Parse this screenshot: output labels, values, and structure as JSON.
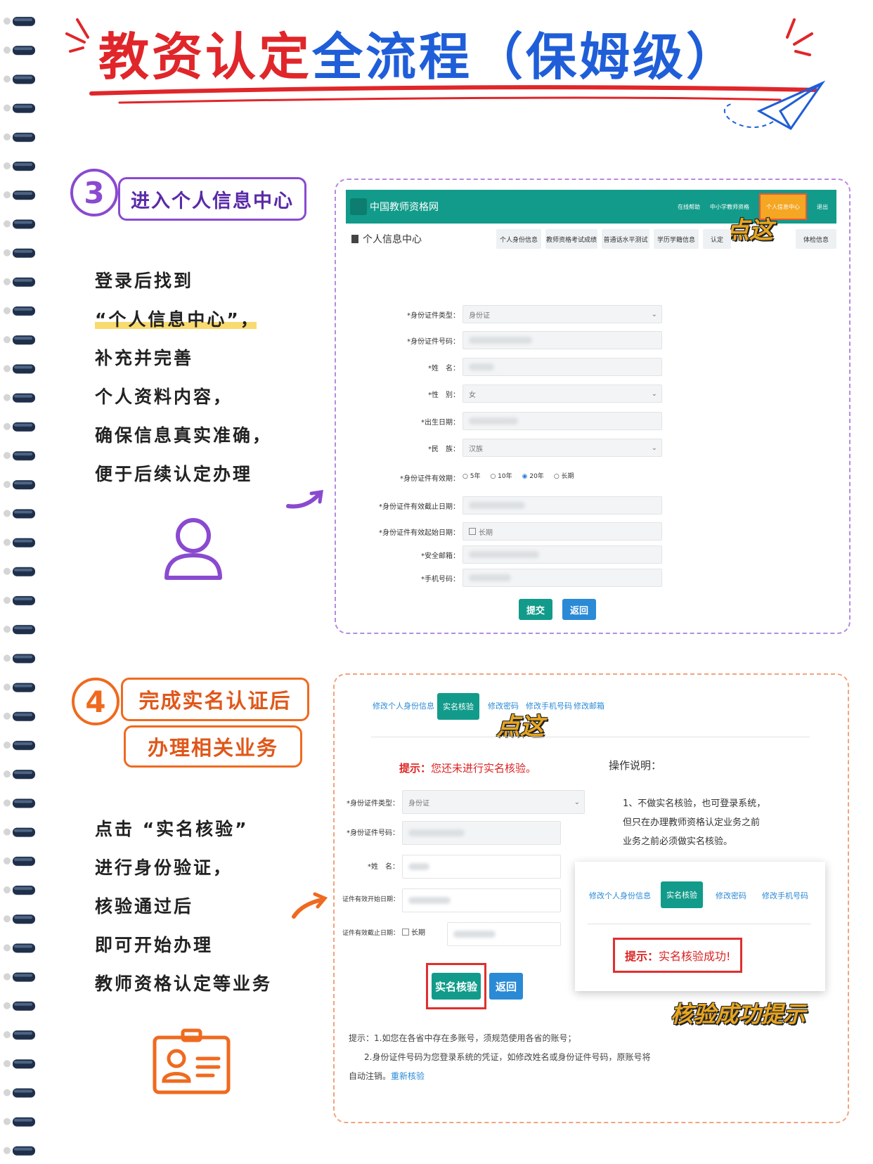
{
  "title": {
    "part1": "教资认定",
    "part2": "全流程（保姆级）"
  },
  "step3": {
    "number": "3",
    "heading": "进入个人信息中心",
    "lines": [
      "登录后找到",
      "“个人信息中心”，",
      "补充并完善",
      "个人资料内容，",
      "确保信息真实准确，",
      "便于后续认定办理"
    ],
    "icon": "person-icon"
  },
  "screen3": {
    "site_name": "中国教师资格网",
    "header_links": [
      "在线帮助",
      "中小学教师资格",
      "个人信息中心",
      "退出"
    ],
    "callout": "点这",
    "section_title": "个人信息中心",
    "tabs": [
      "个人身份信息",
      "教师资格考试成绩",
      "普通话水平测试",
      "学历学籍信息",
      "认定",
      "体检信息"
    ],
    "fields": [
      {
        "label": "*身份证件类型：",
        "value": "身份证",
        "select": true
      },
      {
        "label": "*身份证件号码：",
        "value": ""
      },
      {
        "label": "*姓　名：",
        "value": ""
      },
      {
        "label": "*性　别：",
        "value": "女",
        "select": true
      },
      {
        "label": "*出生日期：",
        "value": ""
      },
      {
        "label": "*民　族：",
        "value": "汉族",
        "select": true
      }
    ],
    "validity_label": "*身份证件有效期：",
    "validity_options": [
      "5年",
      "10年",
      "20年",
      "长期"
    ],
    "validity_selected": "20年",
    "fields2": [
      {
        "label": "*身份证件有效截止日期：",
        "value": ""
      },
      {
        "label": "*身份证件有效起始日期：",
        "value": "长期",
        "checkbox": true
      },
      {
        "label": "*安全邮箱：",
        "value": ""
      },
      {
        "label": "*手机号码：",
        "value": ""
      }
    ],
    "submit": "提交",
    "back": "返回"
  },
  "step4": {
    "number": "4",
    "heading1": "完成实名认证后",
    "heading2": "办理相关业务",
    "lines": [
      "点击 “实名核验”",
      "进行身份验证，",
      "核验通过后",
      "即可开始办理",
      "教师资格认定等业务"
    ],
    "icon": "id-card-icon"
  },
  "screen4": {
    "tabs": [
      "修改个人身份信息",
      "实名核验",
      "修改密码",
      "修改手机号码",
      "修改邮箱"
    ],
    "callout": "点这",
    "notice_label": "提示：",
    "notice_text": "您还未进行实名核验。",
    "instructions_title": "操作说明：",
    "instructions": [
      "1、不做实名核验，也可登录系统，",
      "但只在办理教师资格认定业务之前",
      "业务之前必须做实名核验。"
    ],
    "fields": [
      {
        "label": "*身份证件类型：",
        "value": "身份证",
        "select": true
      },
      {
        "label": "*身份证件号码：",
        "value": ""
      },
      {
        "label": "*姓　名：",
        "value": ""
      },
      {
        "label": "证件有效开始日期：",
        "value": ""
      },
      {
        "label": "证件有效截止日期：",
        "value": "长期",
        "checkbox": true
      }
    ],
    "verify_button": "实名核验",
    "back_button": "返回",
    "tips": [
      "提示：1.如您在各省中存在多账号，须规范使用各省的账号；",
      "2.身份证件号码为您登录系统的凭证，如修改姓名或身份证件号码，原账号将",
      "自动注销。"
    ],
    "tips_link": "重新核验",
    "success_tabs": [
      "修改个人身份信息",
      "实名核验",
      "修改密码",
      "修改手机号码"
    ],
    "success_label": "提示：",
    "success_text": "实名核验成功!",
    "success_caption": "核验成功提示"
  }
}
